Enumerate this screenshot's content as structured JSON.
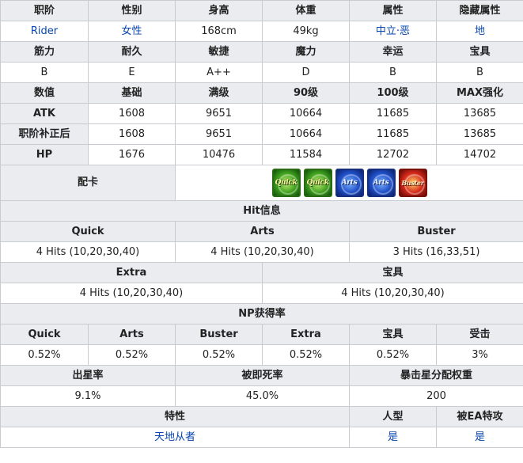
{
  "basic": {
    "headers": [
      "职阶",
      "性别",
      "身高",
      "体重",
      "属性",
      "隐藏属性"
    ],
    "class_name": "Rider",
    "gender": "女性",
    "height": "168cm",
    "weight": "49kg",
    "alignment": "中立·恶",
    "hidden_attribute": "地"
  },
  "params": {
    "headers": [
      "筋力",
      "耐久",
      "敏捷",
      "魔力",
      "幸运",
      "宝具"
    ],
    "values": [
      "B",
      "E",
      "A++",
      "D",
      "B",
      "B"
    ]
  },
  "stats": {
    "headers": [
      "数值",
      "基础",
      "满级",
      "90级",
      "100级",
      "MAX强化"
    ],
    "rows": [
      {
        "label": "ATK",
        "values": [
          "1608",
          "9651",
          "10664",
          "11685",
          "13685"
        ]
      },
      {
        "label": "职阶补正后",
        "values": [
          "1608",
          "9651",
          "10664",
          "11685",
          "13685"
        ]
      },
      {
        "label": "HP",
        "values": [
          "1676",
          "10476",
          "11584",
          "12702",
          "14702"
        ]
      }
    ]
  },
  "cards": {
    "label": "配卡",
    "deck": [
      {
        "type": "quick",
        "text": "Quick"
      },
      {
        "type": "quick",
        "text": "Quick"
      },
      {
        "type": "arts",
        "text": "Arts"
      },
      {
        "type": "arts",
        "text": "Arts"
      },
      {
        "type": "buster",
        "text": "Buster"
      }
    ]
  },
  "hits": {
    "title": "Hit信息",
    "quick_label": "Quick",
    "arts_label": "Arts",
    "buster_label": "Buster",
    "quick": "4 Hits (10,20,30,40)",
    "arts": "4 Hits (10,20,30,40)",
    "buster": "3 Hits (16,33,51)",
    "extra_label": "Extra",
    "np_label": "宝具",
    "extra": "4 Hits (10,20,30,40)",
    "np": "4 Hits (10,20,30,40)"
  },
  "np_gain": {
    "title": "NP获得率",
    "headers": [
      "Quick",
      "Arts",
      "Buster",
      "Extra",
      "宝具",
      "受击"
    ],
    "values": [
      "0.52%",
      "0.52%",
      "0.52%",
      "0.52%",
      "0.52%",
      "3%"
    ]
  },
  "star": {
    "headers": [
      "出星率",
      "被即死率",
      "暴击星分配权重"
    ],
    "values": [
      "9.1%",
      "45.0%",
      "200"
    ]
  },
  "traits": {
    "headers": [
      "特性",
      "人型",
      "被EA特攻"
    ],
    "values": [
      "天地从者",
      "是",
      "是"
    ]
  },
  "colors": {
    "header_bg": "#eaecf0",
    "border": "#c8ccd1",
    "link": "#0645ad"
  }
}
